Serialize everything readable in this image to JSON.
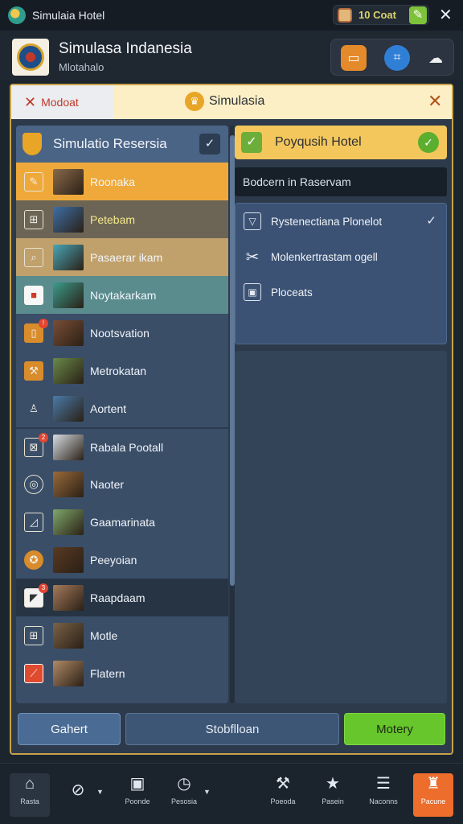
{
  "topbar": {
    "app_title": "Simulaia Hotel",
    "coins": "10 Coat",
    "close": "✕"
  },
  "header": {
    "title": "Simulasa Indanesia",
    "subtitle": "Mlotahalo"
  },
  "dialog": {
    "tab_label": "Modoat",
    "title": "Simulasia",
    "close": "✕",
    "left_panel": {
      "title": "Simulatio Resersia",
      "rooms": [
        {
          "label": "Roonaka",
          "thumb": "#8a6a4a"
        },
        {
          "label": "Petebam",
          "thumb": "#3e6fa8"
        },
        {
          "label": "Pasaerar ikam",
          "thumb": "#49a6b8"
        },
        {
          "label": "Noytakarkam",
          "thumb": "#3b9c8c"
        },
        {
          "label": "Nootsvation",
          "thumb": "#7a4e35"
        },
        {
          "label": "Metrokatan",
          "thumb": "#6a8a4a"
        },
        {
          "label": "Aortent",
          "thumb": "#4a7aa8"
        },
        {
          "label": "Rabala Pootall",
          "thumb": "#d7dde2"
        },
        {
          "label": "Naoter",
          "thumb": "#9a6a3a"
        },
        {
          "label": "Gaamarinata",
          "thumb": "#7fa86a"
        },
        {
          "label": "Peeyoian",
          "thumb": "#5a3a22"
        },
        {
          "label": "Raapdaam",
          "thumb": "#a57a5a"
        },
        {
          "label": "Motle",
          "thumb": "#7a6248"
        },
        {
          "label": "Flatern",
          "thumb": "#b08a66"
        }
      ]
    },
    "right_panel": {
      "title": "Poyqusih Hotel",
      "field": "Bodcern in Raservam",
      "options": [
        {
          "label": "Rystenectiana Plonelot",
          "icon": "cup-icon",
          "checked": true
        },
        {
          "label": "Molenkertrastam ogell",
          "icon": "tools-icon",
          "checked": false
        },
        {
          "label": "Ploceats",
          "icon": "box-icon",
          "checked": false
        }
      ]
    },
    "buttons": {
      "cancel": "Gahert",
      "middle": "Stobflloan",
      "confirm": "Motery"
    }
  },
  "bottom_nav": [
    {
      "label": "Rasta",
      "icon": "home-icon"
    },
    {
      "label": "",
      "icon": "compass-icon"
    },
    {
      "label": "Poonde",
      "icon": "building-icon"
    },
    {
      "label": "Pesosia",
      "icon": "clock-icon"
    },
    {
      "label": "Poeoda",
      "icon": "wrench-icon"
    },
    {
      "label": "Pasein",
      "icon": "star-icon"
    },
    {
      "label": "Naconns",
      "icon": "list-icon"
    },
    {
      "label": "Pacune",
      "icon": "shop-icon"
    }
  ],
  "colors": {
    "accent": "#c8a24a",
    "confirm": "#66c62c",
    "cta": "#ec6d2c"
  }
}
